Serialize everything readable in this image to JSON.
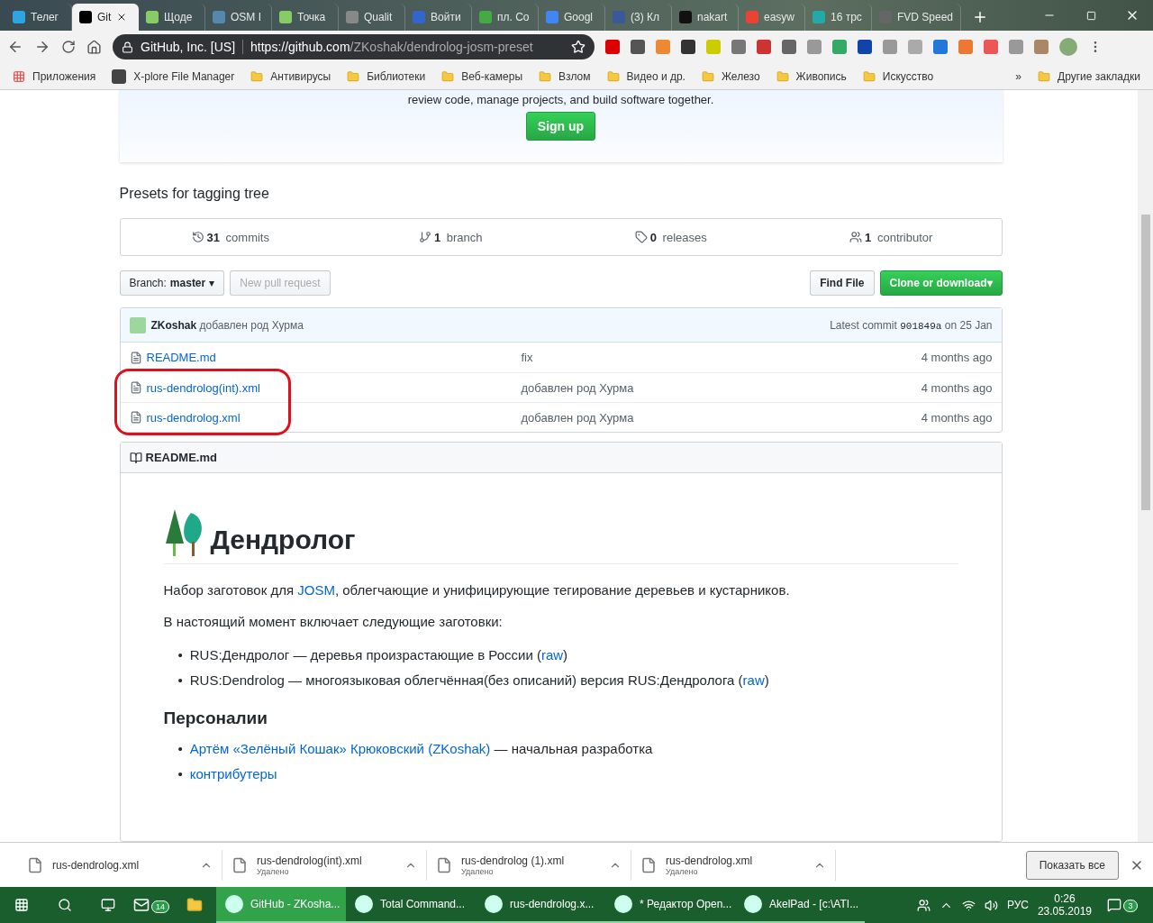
{
  "browser": {
    "tabs": [
      {
        "label": "Телег",
        "selected": false
      },
      {
        "label": "Git",
        "selected": true
      },
      {
        "label": "Щоде",
        "selected": false
      },
      {
        "label": "OSM I",
        "selected": false
      },
      {
        "label": "Точка",
        "selected": false
      },
      {
        "label": "Qualit",
        "selected": false
      },
      {
        "label": "Войти",
        "selected": false
      },
      {
        "label": "пл. Co",
        "selected": false
      },
      {
        "label": "Googl",
        "selected": false
      },
      {
        "label": "(3) Кл",
        "selected": false
      },
      {
        "label": "nakart",
        "selected": false
      },
      {
        "label": "easyw",
        "selected": false
      },
      {
        "label": "16 трс",
        "selected": false
      },
      {
        "label": "FVD Speed",
        "selected": false
      }
    ],
    "site_identity": "GitHub, Inc. [US]",
    "url_host": "https://github.com",
    "url_path": "/ZKoshak/dendrolog-josm-preset",
    "bookmarks": [
      {
        "label": "Приложения",
        "kind": "apps"
      },
      {
        "label": "X-plore File Manager",
        "kind": "app"
      },
      {
        "label": "Антивирусы",
        "kind": "folder"
      },
      {
        "label": "Библиотеки",
        "kind": "folder"
      },
      {
        "label": "Веб-камеры",
        "kind": "folder"
      },
      {
        "label": "Взлом",
        "kind": "folder"
      },
      {
        "label": "Видео и др.",
        "kind": "folder"
      },
      {
        "label": "Железо",
        "kind": "folder"
      },
      {
        "label": "Живопись",
        "kind": "folder"
      },
      {
        "label": "Искусство",
        "kind": "folder"
      }
    ],
    "bookmarks_more": "»",
    "other_bookmarks": "Другие закладки"
  },
  "page": {
    "signup_text": "review code, manage projects, and build software together.",
    "signup_button": "Sign up",
    "description": "Presets for tagging tree",
    "stats": [
      {
        "kind": "commits",
        "count": "31",
        "label": "commits"
      },
      {
        "kind": "branch",
        "count": "1",
        "label": "branch"
      },
      {
        "kind": "releases",
        "count": "0",
        "label": "releases"
      },
      {
        "kind": "contributors",
        "count": "1",
        "label": "contributor"
      }
    ],
    "branch_button": {
      "prefix": "Branch:",
      "value": "master",
      "caret": "▾"
    },
    "new_pull_request": {
      "label": "New pull request",
      "disabled": true
    },
    "find_file": "Find File",
    "clone_button": {
      "label": "Clone or download",
      "caret": "▾"
    },
    "latest_commit": {
      "author": "ZKoshak",
      "message": "добавлен род Хурма",
      "prefix": "Latest commit",
      "sha": "901849a",
      "date": "on 25 Jan"
    },
    "files": [
      {
        "name": "README.md",
        "message": "fix",
        "age": "4 months ago",
        "highlighted": false
      },
      {
        "name": "rus-dendrolog(int).xml",
        "message": "добавлен род Хурма",
        "age": "4 months ago",
        "highlighted": true
      },
      {
        "name": "rus-dendrolog.xml",
        "message": "добавлен род Хурма",
        "age": "4 months ago",
        "highlighted": true
      }
    ],
    "readme": {
      "header": "README.md",
      "title": "Дендролог",
      "intro": "Набор заготовок для ",
      "intro_link": "JOSM",
      "intro_rest": ", облегчающие и унифицирующие тегирование деревьев и кустарников.",
      "includes": "В настоящий момент включает следующие заготовки:",
      "presets": [
        {
          "bullet": "•",
          "text": "RUS:Дендролог — деревья произрастающие в России (",
          "link": "raw",
          "end": ")"
        },
        {
          "bullet": "•",
          "text": "RUS:Dendrolog — многоязыковая облегчённая(без описаний) версия RUS:Дендролога (",
          "link": "raw",
          "end": ")"
        }
      ],
      "people_heading": "Персоналии",
      "people": [
        {
          "bullet": "•",
          "link": "Артём «Зелёный Кошак» Крюковский (ZKoshak)",
          "text": " — начальная разработка"
        },
        {
          "bullet": "•",
          "link": "контрибутеры"
        }
      ]
    }
  },
  "downloads": {
    "items": [
      {
        "name": "rus-dendrolog.xml"
      },
      {
        "name": "rus-dendrolog(int).xml",
        "status": "Удалено"
      },
      {
        "name": "rus-dendrolog (1).xml",
        "status": "Удалено"
      },
      {
        "name": "rus-dendrolog.xml",
        "status": "Удалено"
      }
    ],
    "show_all": "Показать все"
  },
  "taskbar": {
    "mail_badge": "14",
    "apps": [
      {
        "label": "GitHub - ZKosha...",
        "selected": true
      },
      {
        "label": "Total Command...",
        "selected": false
      },
      {
        "label": "rus-dendrolog.x...",
        "selected": false
      },
      {
        "label": "* Редактор Open...",
        "selected": false
      },
      {
        "label": "AkelPad - [c:\\ATI...",
        "selected": false
      }
    ],
    "language": "РУС",
    "time": "0:26",
    "date": "23.05.2019",
    "notification_badge": "3"
  }
}
